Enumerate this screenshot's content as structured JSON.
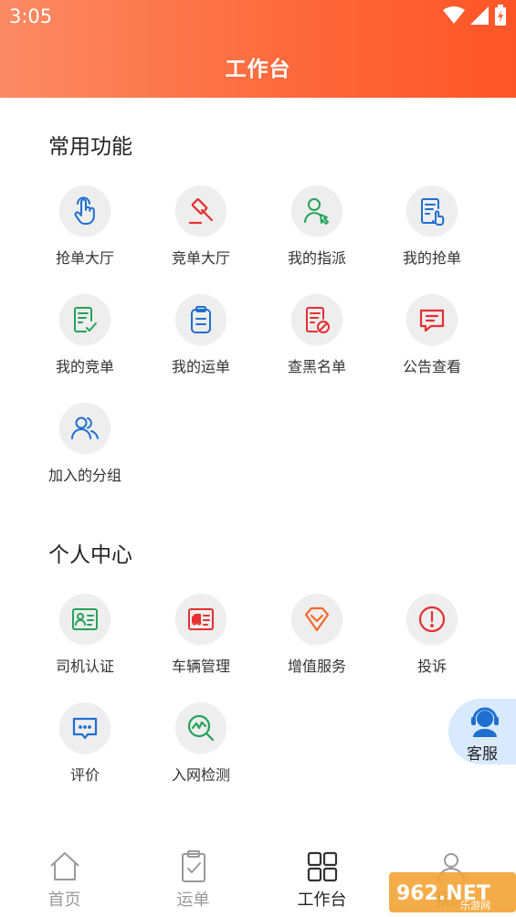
{
  "status_bar": {
    "time": "3:05"
  },
  "header": {
    "title": "工作台"
  },
  "common": {
    "title": "常用功能",
    "items": [
      {
        "label": "抢单大厅",
        "icon": "hand-tap-icon"
      },
      {
        "label": "竞单大厅",
        "icon": "auction-gavel-icon"
      },
      {
        "label": "我的指派",
        "icon": "user-assign-icon"
      },
      {
        "label": "我的抢单",
        "icon": "document-tap-icon"
      },
      {
        "label": "我的竞单",
        "icon": "document-check-icon"
      },
      {
        "label": "我的运单",
        "icon": "clipboard-icon"
      },
      {
        "label": "查黑名单",
        "icon": "blacklist-doc-icon"
      },
      {
        "label": "公告查看",
        "icon": "notice-message-icon"
      },
      {
        "label": "加入的分组",
        "icon": "group-users-icon"
      }
    ]
  },
  "personal": {
    "title": "个人中心",
    "items": [
      {
        "label": "司机认证",
        "icon": "id-card-icon"
      },
      {
        "label": "车辆管理",
        "icon": "vehicle-card-icon"
      },
      {
        "label": "增值服务",
        "icon": "diamond-service-icon"
      },
      {
        "label": "投诉",
        "icon": "alert-circle-icon"
      },
      {
        "label": "评价",
        "icon": "comment-bubble-icon"
      },
      {
        "label": "入网检测",
        "icon": "network-check-icon"
      }
    ]
  },
  "support": {
    "label": "客服"
  },
  "tabbar": {
    "tabs": [
      {
        "label": "首页",
        "active": false
      },
      {
        "label": "运单",
        "active": false
      },
      {
        "label": "工作台",
        "active": true
      },
      {
        "label": "我的",
        "active": false
      }
    ]
  },
  "watermark": {
    "text": "962.NET",
    "sub": "乐游网"
  },
  "colors": {
    "header_start": "#fb8a64",
    "header_end": "#fe5527",
    "blue": "#1f6fd1",
    "red": "#e5302f",
    "green": "#25a35a",
    "orange": "#f26a2c"
  }
}
